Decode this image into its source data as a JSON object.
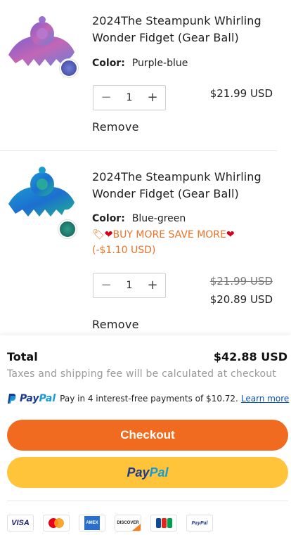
{
  "items": [
    {
      "title": "2024The Steampunk Whirling Wonder Fidget (Gear Ball)",
      "color_key": "Color:",
      "color_value": "Purple-blue",
      "quantity": "1",
      "price": "$21.99 USD",
      "remove_label": "Remove",
      "swatch_color": "#5a62b8"
    },
    {
      "title": "2024The Steampunk Whirling Wonder Fidget (Gear Ball)",
      "color_key": "Color:",
      "color_value": "Blue-green",
      "promo_text": "BUY MORE SAVE MORE",
      "promo_discount": "(-$1.10 USD)",
      "quantity": "1",
      "original_price": "$21.99 USD",
      "price": "$20.89 USD",
      "remove_label": "Remove",
      "swatch_color": "#1f8a7a"
    }
  ],
  "summary": {
    "total_label": "Total",
    "total_value": "$42.88 USD",
    "tax_note": "Taxes and shipping fee will be calculated at checkout",
    "paypal_dark": "Pay",
    "paypal_light": "Pal",
    "paypal_message": "Pay in 4 interest-free payments of $10.72.",
    "paypal_link": "Learn more",
    "checkout_label": "Checkout",
    "paypal_button_dark": "Pay",
    "paypal_button_light": "Pal"
  },
  "payment_methods": [
    "VISA",
    "Mastercard",
    "AMEX",
    "DISCOVER",
    "JCB",
    "PayPal"
  ],
  "colors": {
    "accent_orange": "#f06b1f",
    "paypal_yellow": "#ffc43a",
    "paypal_dark_blue": "#1b3a8e",
    "paypal_light_blue": "#179bd7",
    "promo_orange": "#e8742a"
  }
}
